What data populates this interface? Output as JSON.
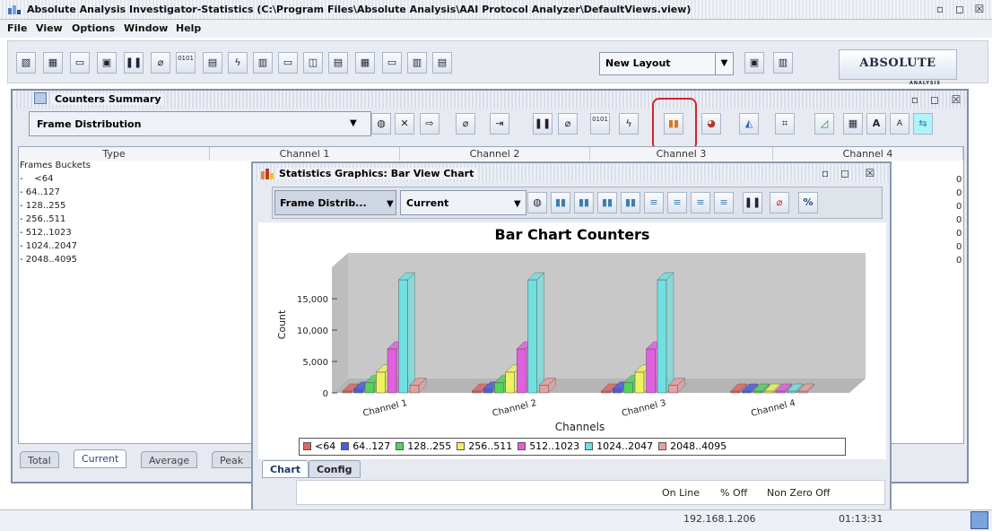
{
  "app": {
    "title": "Absolute Analysis Investigator-Statistics (C:\\Program Files\\Absolute Analysis\\AAI Protocol Analyzer\\DefaultViews.view)",
    "window_controls": [
      "▫",
      "◻",
      "☒"
    ]
  },
  "menu": [
    "File",
    "View",
    "Options",
    "Window",
    "Help"
  ],
  "main_toolbar": {
    "layout_select": "New Layout",
    "logo": "ABSOLUTE",
    "logo_sub": "ANALYSIS",
    "binary_label": "0101"
  },
  "counters_summary": {
    "title": "Counters Summary",
    "view_select": "Frame Distribution",
    "columns": [
      "Type",
      "Channel 1",
      "Channel 2",
      "Channel 3",
      "Channel 4"
    ],
    "rows": [
      {
        "label": "Frames Buckets",
        "ch4": ""
      },
      {
        "label": "-    <64",
        "ch4": "0"
      },
      {
        "label": "- 64..127",
        "ch4": "0"
      },
      {
        "label": "- 128..255",
        "ch4": "0"
      },
      {
        "label": "- 256..511",
        "ch4": "0"
      },
      {
        "label": "- 512..1023",
        "ch4": "0"
      },
      {
        "label": "- 1024..2047",
        "ch4": "0"
      },
      {
        "label": "- 2048..4095",
        "ch4": "0"
      }
    ],
    "tabs": [
      "Total",
      "Current",
      "Average",
      "Peak"
    ],
    "active_tab": "Current"
  },
  "statistics_graphics": {
    "title": "Statistics Graphics: Bar View Chart",
    "view_select": "Frame Distrib...",
    "mode_select": "Current",
    "percent_label": "%",
    "tabs": [
      "Chart",
      "Config"
    ],
    "status": {
      "online": "On Line",
      "percent": "% Off",
      "nonzero": "Non Zero Off"
    }
  },
  "chart_data": {
    "type": "bar",
    "title": "Bar Chart Counters",
    "xlabel": "Channels",
    "ylabel": "Count",
    "ylim": [
      0,
      20000
    ],
    "yticks": [
      "0",
      "5,000",
      "10,000",
      "15,000"
    ],
    "categories": [
      "Channel 1",
      "Channel 2",
      "Channel 3",
      "Channel 4"
    ],
    "legend_position": "bottom",
    "series": [
      {
        "name": "<64",
        "color": "#e06666",
        "values": [
          100,
          100,
          100,
          0
        ]
      },
      {
        "name": "64..127",
        "color": "#4a5de0",
        "values": [
          600,
          600,
          600,
          0
        ]
      },
      {
        "name": "128..255",
        "color": "#52d35a",
        "values": [
          1600,
          1600,
          1600,
          0
        ]
      },
      {
        "name": "256..511",
        "color": "#f0f060",
        "values": [
          3300,
          3300,
          3300,
          0
        ]
      },
      {
        "name": "512..1023",
        "color": "#e060e0",
        "values": [
          7000,
          7000,
          7000,
          0
        ]
      },
      {
        "name": "1024..2047",
        "color": "#70e0e0",
        "values": [
          18000,
          18000,
          18000,
          0
        ]
      },
      {
        "name": "2048..4095",
        "color": "#e5a0a0",
        "values": [
          1200,
          1200,
          1200,
          0
        ]
      }
    ]
  },
  "statusbar": {
    "ip": "192.168.1.206",
    "time": "01:13:31"
  },
  "colors": {
    "highlight": "#d1242e",
    "frame_border": "#7d8ea8"
  }
}
